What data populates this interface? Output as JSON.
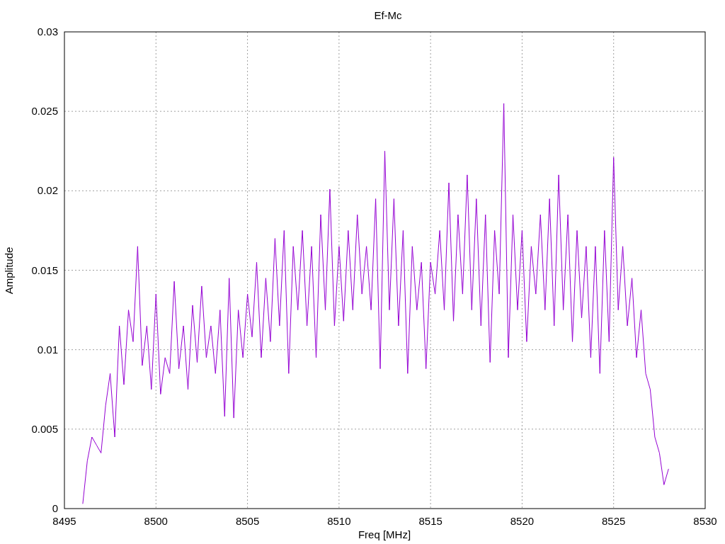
{
  "chart_data": {
    "type": "line",
    "title": "Ef-Mc",
    "xlabel": "Freq [MHz]",
    "ylabel": "Amplitude",
    "grid": true,
    "xlim": [
      8495,
      8530
    ],
    "ylim": [
      0,
      0.03
    ],
    "xticks": [
      8495,
      8500,
      8505,
      8510,
      8515,
      8520,
      8525,
      8530
    ],
    "yticks": [
      {
        "value": 0,
        "label": "0"
      },
      {
        "value": 0.005,
        "label": "0.005"
      },
      {
        "value": 0.01,
        "label": "0.01"
      },
      {
        "value": 0.015,
        "label": "0.015"
      },
      {
        "value": 0.02,
        "label": "0.02"
      },
      {
        "value": 0.025,
        "label": "0.025"
      },
      {
        "value": 0.03,
        "label": "0.03"
      }
    ],
    "x": [
      8496,
      8496.25,
      8496.5,
      8496.75,
      8497,
      8497.25,
      8497.5,
      8497.75,
      8498,
      8498.25,
      8498.5,
      8498.75,
      8499,
      8499.25,
      8499.5,
      8499.75,
      8500,
      8500.25,
      8500.5,
      8500.75,
      8501,
      8501.25,
      8501.5,
      8501.75,
      8502,
      8502.25,
      8502.5,
      8502.75,
      8503,
      8503.25,
      8503.5,
      8503.75,
      8504,
      8504.25,
      8504.5,
      8504.75,
      8505,
      8505.25,
      8505.5,
      8505.75,
      8506,
      8506.25,
      8506.5,
      8506.75,
      8507,
      8507.25,
      8507.5,
      8507.75,
      8508,
      8508.25,
      8508.5,
      8508.75,
      8509,
      8509.25,
      8509.5,
      8509.75,
      8510,
      8510.25,
      8510.5,
      8510.75,
      8511,
      8511.25,
      8511.5,
      8511.75,
      8512,
      8512.25,
      8512.5,
      8512.75,
      8513,
      8513.25,
      8513.5,
      8513.75,
      8514,
      8514.25,
      8514.5,
      8514.75,
      8515,
      8515.25,
      8515.5,
      8515.75,
      8516,
      8516.25,
      8516.5,
      8516.75,
      8517,
      8517.25,
      8517.5,
      8517.75,
      8518,
      8518.25,
      8518.5,
      8518.75,
      8519,
      8519.25,
      8519.5,
      8519.75,
      8520,
      8520.25,
      8520.5,
      8520.75,
      8521,
      8521.25,
      8521.5,
      8521.75,
      8522,
      8522.25,
      8522.5,
      8522.75,
      8523,
      8523.25,
      8523.5,
      8523.75,
      8524,
      8524.25,
      8524.5,
      8524.75,
      8525,
      8525.25,
      8525.5,
      8525.75,
      8526,
      8526.25,
      8526.5,
      8526.75,
      8527,
      8527.25,
      8527.5,
      8527.75,
      8528
    ],
    "series": [
      {
        "color": "#9400d3",
        "values": [
          0.0003,
          0.003,
          0.0045,
          0.004,
          0.0035,
          0.0065,
          0.0085,
          0.0045,
          0.0115,
          0.0078,
          0.0125,
          0.0105,
          0.0165,
          0.009,
          0.0115,
          0.0075,
          0.0135,
          0.0072,
          0.0095,
          0.0085,
          0.0143,
          0.0088,
          0.0115,
          0.0075,
          0.0128,
          0.0092,
          0.014,
          0.0095,
          0.0115,
          0.0085,
          0.0125,
          0.0058,
          0.0145,
          0.0057,
          0.0125,
          0.0095,
          0.0135,
          0.0108,
          0.0155,
          0.0095,
          0.0145,
          0.0105,
          0.017,
          0.0115,
          0.0175,
          0.0085,
          0.0165,
          0.0125,
          0.0175,
          0.0115,
          0.0165,
          0.0095,
          0.0185,
          0.0125,
          0.0201,
          0.0115,
          0.0165,
          0.0118,
          0.0175,
          0.0125,
          0.0185,
          0.0135,
          0.0165,
          0.0125,
          0.0195,
          0.0088,
          0.0225,
          0.0125,
          0.0195,
          0.0115,
          0.0175,
          0.0085,
          0.0165,
          0.0125,
          0.0155,
          0.0088,
          0.0155,
          0.0135,
          0.0175,
          0.0125,
          0.0205,
          0.0118,
          0.0185,
          0.0135,
          0.021,
          0.0125,
          0.0195,
          0.0115,
          0.0185,
          0.0092,
          0.0175,
          0.0135,
          0.0255,
          0.0095,
          0.0185,
          0.0125,
          0.0175,
          0.0105,
          0.0165,
          0.0135,
          0.0185,
          0.0125,
          0.0195,
          0.0115,
          0.021,
          0.0125,
          0.0185,
          0.0105,
          0.0175,
          0.012,
          0.0165,
          0.0095,
          0.0165,
          0.0085,
          0.0175,
          0.0105,
          0.0221,
          0.0125,
          0.0165,
          0.0115,
          0.0145,
          0.0095,
          0.0125,
          0.0085,
          0.0075,
          0.0045,
          0.0035,
          0.0015,
          0.0025
        ]
      }
    ]
  }
}
